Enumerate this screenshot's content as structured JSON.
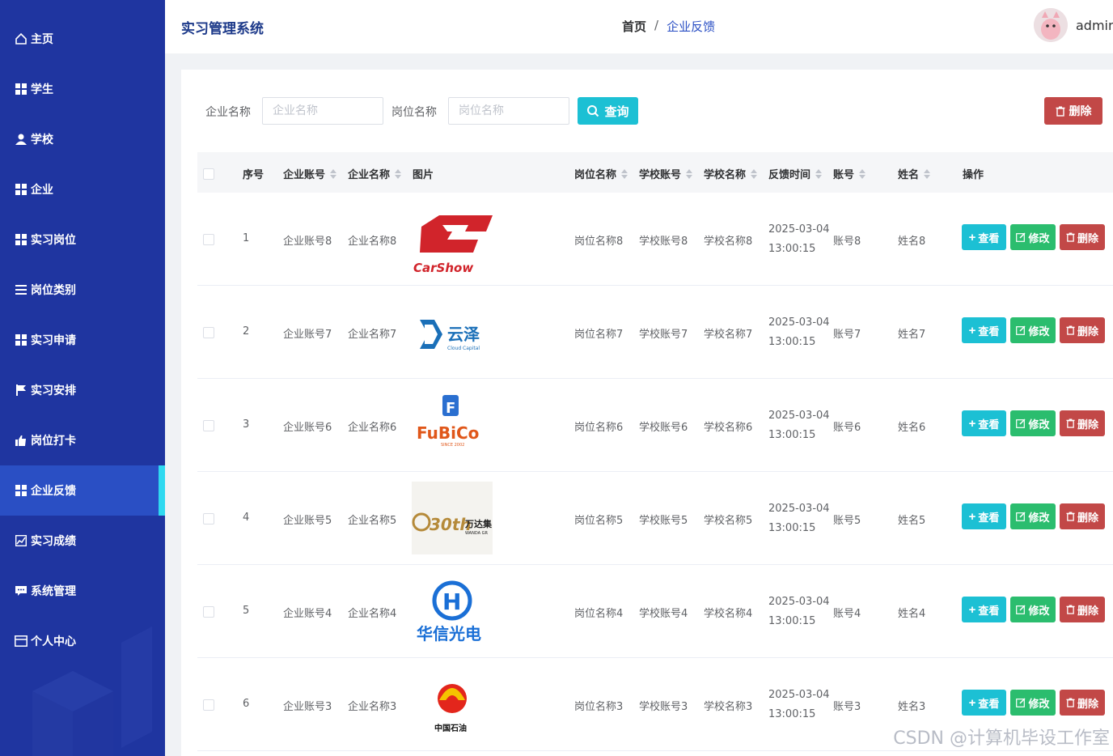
{
  "app": {
    "title": "实习管理系统"
  },
  "breadcrumb": {
    "home": "首页",
    "separator": "/",
    "current": "企业反馈"
  },
  "user": {
    "name": "admin"
  },
  "sidebar": {
    "items": [
      {
        "label": "主页",
        "icon": "home-icon"
      },
      {
        "label": "学生",
        "icon": "grid-icon"
      },
      {
        "label": "学校",
        "icon": "user-icon"
      },
      {
        "label": "企业",
        "icon": "grid-icon"
      },
      {
        "label": "实习岗位",
        "icon": "grid-icon"
      },
      {
        "label": "岗位类别",
        "icon": "list-icon"
      },
      {
        "label": "实习申请",
        "icon": "grid-icon"
      },
      {
        "label": "实习安排",
        "icon": "flag-icon"
      },
      {
        "label": "岗位打卡",
        "icon": "thumb-icon"
      },
      {
        "label": "企业反馈",
        "icon": "grid-icon",
        "active": true
      },
      {
        "label": "实习成绩",
        "icon": "chart-icon"
      },
      {
        "label": "系统管理",
        "icon": "chat-icon"
      },
      {
        "label": "个人中心",
        "icon": "card-icon"
      }
    ]
  },
  "search": {
    "company_label": "企业名称",
    "company_placeholder": "企业名称",
    "position_label": "岗位名称",
    "position_placeholder": "岗位名称",
    "query_label": "查询",
    "delete_label": "删除"
  },
  "table": {
    "headers": {
      "index": "序号",
      "company_account": "企业账号",
      "company_name": "企业名称",
      "image": "图片",
      "position_name": "岗位名称",
      "school_account": "学校账号",
      "school_name": "学校名称",
      "feedback_time": "反馈时间",
      "account": "账号",
      "name": "姓名",
      "actions": "操作"
    },
    "rows": [
      {
        "index": "1",
        "company_account": "企业账号8",
        "company_name": "企业名称8",
        "logo": "CarShow",
        "position_name": "岗位名称8",
        "school_account": "学校账号8",
        "school_name": "学校名称8",
        "date": "2025-03-04",
        "time": "13:00:15",
        "account": "账号8",
        "name": "姓名8"
      },
      {
        "index": "2",
        "company_account": "企业账号7",
        "company_name": "企业名称7",
        "logo": "云泽",
        "logo_sub": "Cloud Capital",
        "position_name": "岗位名称7",
        "school_account": "学校账号7",
        "school_name": "学校名称7",
        "date": "2025-03-04",
        "time": "13:00:15",
        "account": "账号7",
        "name": "姓名7"
      },
      {
        "index": "3",
        "company_account": "企业账号6",
        "company_name": "企业名称6",
        "logo": "FuBiCo",
        "logo_sub": "SINCE 2002",
        "position_name": "岗位名称6",
        "school_account": "学校账号6",
        "school_name": "学校名称6",
        "date": "2025-03-04",
        "time": "13:00:15",
        "account": "账号6",
        "name": "姓名6"
      },
      {
        "index": "4",
        "company_account": "企业账号5",
        "company_name": "企业名称5",
        "logo": "30th",
        "logo_sub": "万达集",
        "logo_sub2": "WANDA GR",
        "position_name": "岗位名称5",
        "school_account": "学校账号5",
        "school_name": "学校名称5",
        "date": "2025-03-04",
        "time": "13:00:15",
        "account": "账号5",
        "name": "姓名5"
      },
      {
        "index": "5",
        "company_account": "企业账号4",
        "company_name": "企业名称4",
        "logo": "华信光电",
        "position_name": "岗位名称4",
        "school_account": "学校账号4",
        "school_name": "学校名称4",
        "date": "2025-03-04",
        "time": "13:00:15",
        "account": "账号4",
        "name": "姓名4"
      },
      {
        "index": "6",
        "company_account": "企业账号3",
        "company_name": "企业名称3",
        "logo": "中国石油",
        "position_name": "岗位名称3",
        "school_account": "学校账号3",
        "school_name": "学校名称3",
        "date": "2025-03-04",
        "time": "13:00:15",
        "account": "账号3",
        "name": "姓名3"
      }
    ],
    "action_labels": {
      "view": "查看",
      "edit": "修改",
      "delete": "删除"
    }
  },
  "watermark": "CSDN @计算机毕设工作室",
  "colors": {
    "sidebar": "#1f35a0",
    "active": "#2a4fc4",
    "accent": "#2fd9f0",
    "view": "#1cc0d4",
    "edit": "#2bbd6e",
    "delete": "#c24847"
  }
}
